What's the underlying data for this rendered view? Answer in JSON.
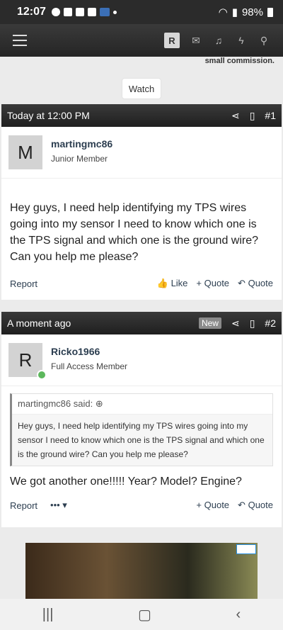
{
  "status_bar": {
    "time": "12:07",
    "battery": "98%"
  },
  "navbar": {
    "badge": "R"
  },
  "banner": {
    "commission_text": "small commission."
  },
  "watch_label": "Watch",
  "posts": [
    {
      "timestamp": "Today at 12:00 PM",
      "number": "#1",
      "avatar_letter": "M",
      "author": "martingmc86",
      "author_title": "Junior Member",
      "message": "Hey guys, I need help identifying my TPS wires going into my sensor I need to know which one is the TPS signal and which one is the ground wire? Can you help me please?",
      "report": "Report",
      "like": "Like",
      "add_quote": "+ Quote",
      "quote": "Quote"
    },
    {
      "timestamp": "A moment ago",
      "new_badge": "New",
      "number": "#2",
      "avatar_letter": "R",
      "author": "Ricko1966",
      "author_title": "Full Access Member",
      "quote_author": "martingmc86 said:",
      "quote_text": "Hey guys, I need help identifying my TPS wires going into my sensor I need to know which one is the TPS signal and which one is the ground wire? Can you help me please?",
      "message": "We got another one!!!!! Year? Model? Engine?",
      "report": "Report",
      "more": "••• ▾",
      "add_quote": "+ Quote",
      "quote": "Quote"
    }
  ],
  "icons": [
    "hamburger-icon",
    "mail-icon",
    "bell-icon",
    "bolt-icon",
    "search-icon",
    "share-icon",
    "bookmark-icon",
    "thumbs-up-icon",
    "reply-icon"
  ]
}
